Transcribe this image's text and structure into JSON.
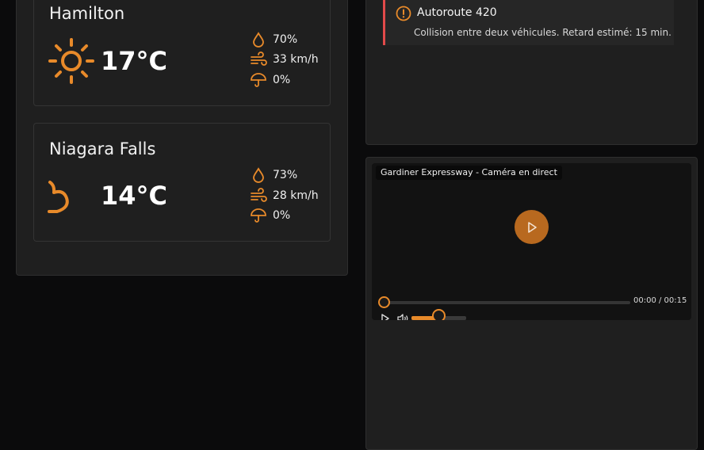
{
  "weather": {
    "cities": [
      {
        "name": "Hamilton",
        "temp": "17°C",
        "condition_icon": "sun-icon",
        "humidity": "70%",
        "wind": "33 km/h",
        "precip": "0%"
      },
      {
        "name": "Niagara Falls",
        "temp": "14°C",
        "condition_icon": "moon-icon",
        "humidity": "73%",
        "wind": "28 km/h",
        "precip": "0%"
      }
    ]
  },
  "traffic": {
    "alerts": [
      {
        "title": "Autoroute 420",
        "description": "Collision entre deux véhicules. Retard estimé: 15 min.",
        "icon": "alert-circle-icon"
      }
    ]
  },
  "camera": {
    "label": "Gardiner Expressway - Caméra en direct",
    "time_display": "00:00 / 00:15",
    "progress": 0,
    "volume": 0.5
  },
  "colors": {
    "accent": "#e88a2a",
    "alert": "#e24a4a",
    "panel": "#1f1f1f",
    "background": "#0b0b0c"
  }
}
